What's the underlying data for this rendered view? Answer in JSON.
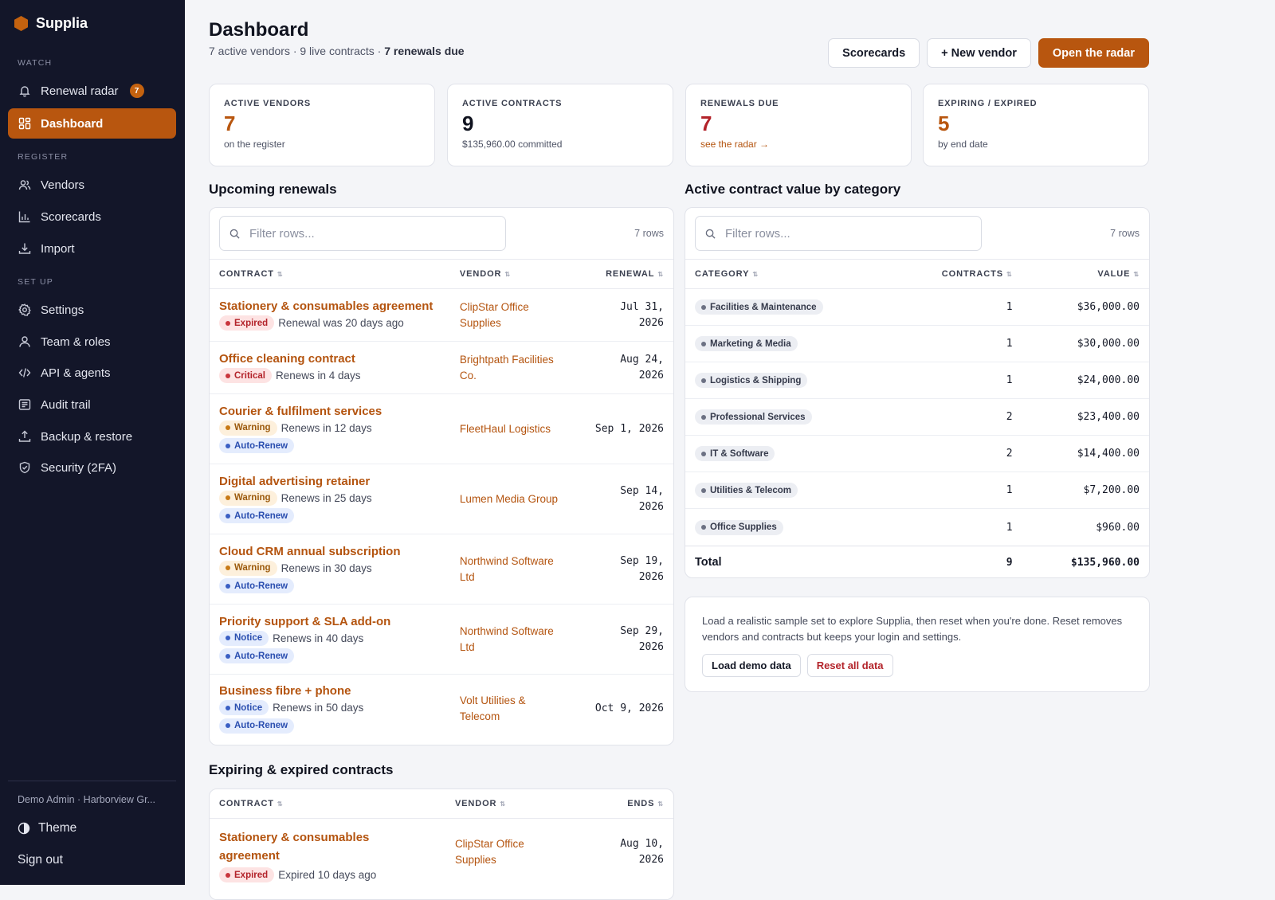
{
  "brand": {
    "name": "Supplia",
    "color": "#c4620f"
  },
  "sidebar": {
    "sections": {
      "watch": "WATCH",
      "register": "REGISTER",
      "setup": "SET UP"
    },
    "items": {
      "renewal_radar": {
        "label": "Renewal radar",
        "badge": "7",
        "icon": "bell-icon"
      },
      "dashboard": {
        "label": "Dashboard",
        "icon": "grid-icon"
      },
      "vendors": {
        "label": "Vendors",
        "icon": "users-icon"
      },
      "scorecards": {
        "label": "Scorecards",
        "icon": "bar-chart-icon"
      },
      "import": {
        "label": "Import",
        "icon": "download-icon"
      },
      "settings": {
        "label": "Settings",
        "icon": "gear-icon"
      },
      "team": {
        "label": "Team & roles",
        "icon": "user-icon"
      },
      "api": {
        "label": "API & agents",
        "icon": "code-icon"
      },
      "audit": {
        "label": "Audit trail",
        "icon": "list-icon"
      },
      "backup": {
        "label": "Backup & restore",
        "icon": "upload-icon"
      },
      "security": {
        "label": "Security (2FA)",
        "icon": "shield-icon"
      }
    },
    "user": "Demo Admin · Harborview Gr...",
    "theme": "Theme",
    "signout": "Sign out"
  },
  "header": {
    "title": "Dashboard",
    "sub_prefix": "7 active vendors · 9 live contracts · ",
    "sub_bold": "7 renewals due",
    "actions": {
      "scorecards": "Scorecards",
      "new_vendor": "+ New vendor",
      "radar": "Open the radar"
    }
  },
  "stats": [
    {
      "label": "ACTIVE VENDORS",
      "value": "7",
      "note": "on the register",
      "color": "#b8560f"
    },
    {
      "label": "ACTIVE CONTRACTS",
      "value": "9",
      "note": "$135,960.00 committed",
      "color": "#10131f"
    },
    {
      "label": "RENEWALS DUE",
      "value": "7",
      "note": "see the radar →",
      "color": "#b3232a"
    },
    {
      "label": "EXPIRING / EXPIRED",
      "value": "5",
      "note": "by end date",
      "color": "#b8560f"
    }
  ],
  "renewals": {
    "title": "Upcoming renewals",
    "filter_placeholder": "Filter rows...",
    "rowcount": "7 rows",
    "headers": {
      "contract": "CONTRACT",
      "vendor": "VENDOR",
      "renewal": "RENEWAL"
    },
    "rows": [
      {
        "contract": "Stationery & consumables agreement",
        "status": "Expired",
        "status_kind": "expired",
        "note": "Renewal was 20 days ago",
        "auto": "",
        "vendor1": "ClipStar Office",
        "vendor2": "Supplies",
        "date1": "Jul 31,",
        "date2": "2026"
      },
      {
        "contract": "Office cleaning contract",
        "status": "Critical",
        "status_kind": "critical",
        "note": "Renews in 4 days",
        "auto": "",
        "vendor1": "Brightpath Facilities",
        "vendor2": "Co.",
        "date1": "Aug 24,",
        "date2": "2026"
      },
      {
        "contract": "Courier & fulfilment services",
        "status": "Warning",
        "status_kind": "warning",
        "note": "Renews in 12 days",
        "auto": "Auto-Renew",
        "vendor1": "FleetHaul Logistics",
        "vendor2": "",
        "date1": "Sep 1, 2026",
        "date2": ""
      },
      {
        "contract": "Digital advertising retainer",
        "status": "Warning",
        "status_kind": "warning",
        "note": "Renews in 25 days",
        "auto": "Auto-Renew",
        "vendor1": "Lumen Media Group",
        "vendor2": "",
        "date1": "Sep 14,",
        "date2": "2026"
      },
      {
        "contract": "Cloud CRM annual subscription",
        "status": "Warning",
        "status_kind": "warning",
        "note": "Renews in 30 days",
        "auto": "Auto-Renew",
        "vendor1": "Northwind Software",
        "vendor2": "Ltd",
        "date1": "Sep 19,",
        "date2": "2026"
      },
      {
        "contract": "Priority support & SLA add-on",
        "status": "Notice",
        "status_kind": "notice",
        "note": "Renews in 40 days",
        "auto": "Auto-Renew",
        "vendor1": "Northwind Software",
        "vendor2": "Ltd",
        "date1": "Sep 29,",
        "date2": "2026"
      },
      {
        "contract": "Business fibre + phone",
        "status": "Notice",
        "status_kind": "notice",
        "note": "Renews in 50 days",
        "auto": "Auto-Renew",
        "vendor1": "Volt Utilities &",
        "vendor2": "Telecom",
        "date1": "Oct 9, 2026",
        "date2": ""
      }
    ]
  },
  "categories": {
    "title": "Active contract value by category",
    "filter_placeholder": "Filter rows...",
    "rowcount": "7 rows",
    "headers": {
      "category": "CATEGORY",
      "contracts": "CONTRACTS",
      "value": "VALUE"
    },
    "rows": [
      {
        "category": "Facilities & Maintenance",
        "contracts": "1",
        "value": "$36,000.00"
      },
      {
        "category": "Marketing & Media",
        "contracts": "1",
        "value": "$30,000.00"
      },
      {
        "category": "Logistics & Shipping",
        "contracts": "1",
        "value": "$24,000.00"
      },
      {
        "category": "Professional Services",
        "contracts": "2",
        "value": "$23,400.00"
      },
      {
        "category": "IT & Software",
        "contracts": "2",
        "value": "$14,400.00"
      },
      {
        "category": "Utilities & Telecom",
        "contracts": "1",
        "value": "$7,200.00"
      },
      {
        "category": "Office Supplies",
        "contracts": "1",
        "value": "$960.00"
      }
    ],
    "total": {
      "label": "Total",
      "contracts": "9",
      "value": "$135,960.00"
    }
  },
  "demo": {
    "text": "Load a realistic sample set to explore Supplia, then reset when you're done. Reset removes vendors and contracts but keeps your login and settings.",
    "load": "Load demo data",
    "reset": "Reset all data"
  },
  "expiring": {
    "title": "Expiring & expired contracts",
    "headers": {
      "contract": "CONTRACT",
      "vendor": "VENDOR",
      "ends": "ENDS"
    },
    "rows": [
      {
        "contract1": "Stationery & consumables",
        "contract2": "agreement",
        "status": "Expired",
        "status_kind": "expired",
        "note": "Expired 10 days ago",
        "vendor1": "ClipStar Office",
        "vendor2": "Supplies",
        "date1": "Aug 10,",
        "date2": "2026"
      }
    ]
  }
}
